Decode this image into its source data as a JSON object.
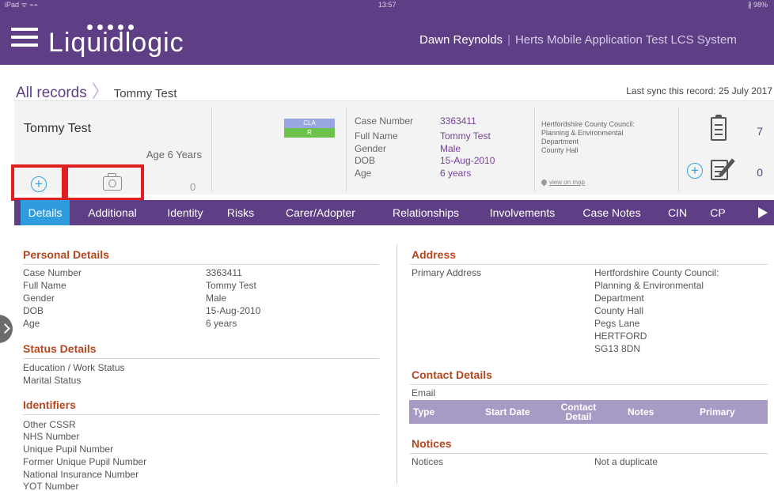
{
  "status_bar": {
    "left": "iPad ᯤ ⌁⌁",
    "time": "13:57",
    "right": "∦ 98%"
  },
  "header": {
    "app_name": "Liquidlogic",
    "user": "Dawn Reynolds",
    "separator": "|",
    "system": "Herts Mobile Application Test LCS System"
  },
  "breadcrumb": {
    "root": "All records",
    "chevron": "〉",
    "current": "Tommy Test"
  },
  "sync": "Last sync this record: 25 July 2017",
  "summary": {
    "name": "Tommy Test",
    "age": "Age 6 Years",
    "photo_count": "0",
    "badges": [
      {
        "label": "CLA",
        "color": "#9aa6e0"
      },
      {
        "label": "R",
        "color": "#6cc24a"
      }
    ],
    "case_fields": [
      {
        "label": "Case Number",
        "value": "3363411"
      },
      {
        "label": "Full Name",
        "value": "Tommy Test"
      },
      {
        "label": "Gender",
        "value": "Male"
      },
      {
        "label": "DOB",
        "value": "15-Aug-2010"
      },
      {
        "label": "Age",
        "value": "6 years"
      }
    ],
    "address_lines": [
      "Hertfordshire County Council:",
      "Planning & Environmental",
      "Department",
      "County Hall"
    ],
    "map_link": "view on map",
    "forms_count": "7",
    "notes_count": "0"
  },
  "tabs": [
    "Details",
    "Additional",
    "Identity",
    "Risks",
    "Carer/Adopter",
    "Relationships",
    "Involvements",
    "Case Notes",
    "CIN",
    "CP"
  ],
  "active_tab": "Details",
  "personal_details": {
    "title": "Personal Details",
    "rows": [
      {
        "label": "Case Number",
        "value": "3363411"
      },
      {
        "label": "Full Name",
        "value": "Tommy Test"
      },
      {
        "label": "Gender",
        "value": "Male"
      },
      {
        "label": "DOB",
        "value": "15-Aug-2010"
      },
      {
        "label": "Age",
        "value": "6 years"
      }
    ]
  },
  "status_details": {
    "title": "Status Details",
    "rows": [
      "Education / Work Status",
      "Marital Status"
    ]
  },
  "identifiers": {
    "title": "Identifiers",
    "rows": [
      "Other CSSR",
      "NHS Number",
      "Unique Pupil Number",
      "Former Unique Pupil Number",
      "National Insurance Number",
      "YOT Number"
    ]
  },
  "address": {
    "title": "Address",
    "label": "Primary Address",
    "lines": [
      "Hertfordshire County Council:",
      "Planning & Environmental",
      "Department",
      "County Hall",
      "Pegs Lane",
      "HERTFORD",
      "SG13 8DN"
    ]
  },
  "contact_details": {
    "title": "Contact Details",
    "sub": "Email",
    "columns": [
      "Type",
      "Start Date",
      "Contact Detail",
      "Notes",
      "Primary"
    ]
  },
  "notices": {
    "title": "Notices",
    "label": "Notices",
    "value": "Not a duplicate"
  },
  "colors": {
    "brand": "#5e3f86",
    "active_tab": "#2f9ddd",
    "section_title": "#b4471f",
    "highlight": "#e02020"
  }
}
